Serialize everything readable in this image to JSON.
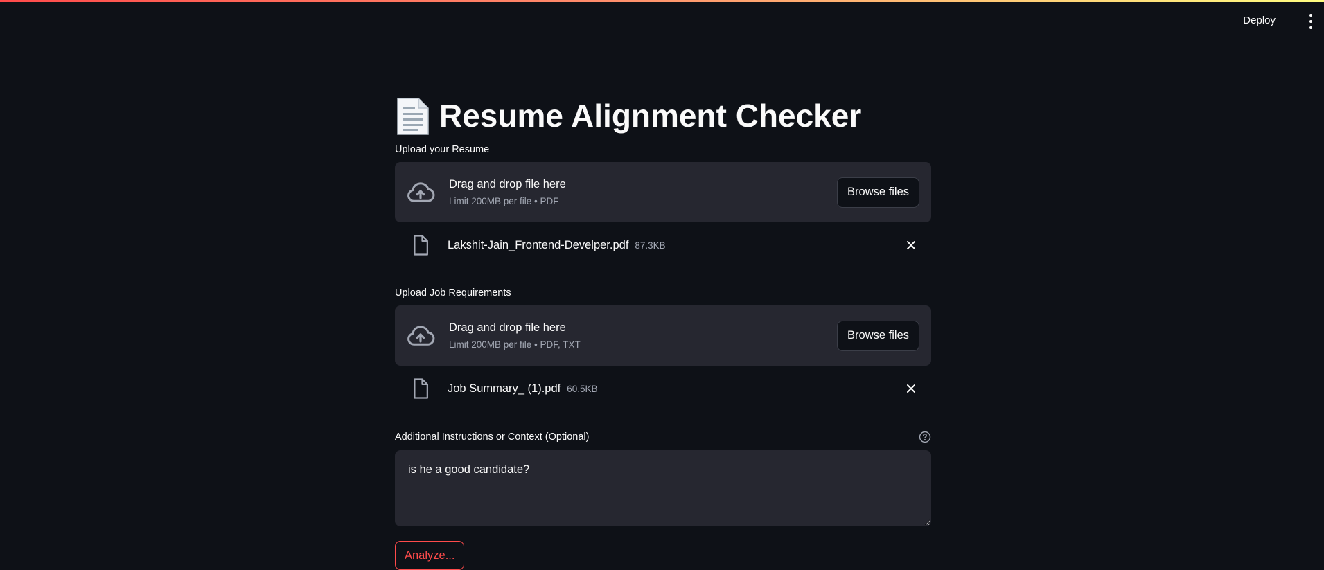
{
  "header": {
    "deploy_label": "Deploy"
  },
  "title": {
    "icon": "page-facing-up-icon",
    "text": "Resume Alignment Checker"
  },
  "resume_upload": {
    "label": "Upload your Resume",
    "drop_text": "Drag and drop file here",
    "limit_text": "Limit 200MB per file • PDF",
    "browse_label": "Browse files",
    "file": {
      "name": "Lakshit-Jain_Frontend-Develper.pdf",
      "size": "87.3KB"
    }
  },
  "job_upload": {
    "label": "Upload Job Requirements",
    "drop_text": "Drag and drop file here",
    "limit_text": "Limit 200MB per file • PDF, TXT",
    "browse_label": "Browse files",
    "file": {
      "name": "Job Summary_ (1).pdf",
      "size": "60.5KB"
    }
  },
  "instructions": {
    "label": "Additional Instructions or Context (Optional)",
    "value": "is he a good candidate?"
  },
  "analyze_label": "Analyze...",
  "colors": {
    "background": "#0e1117",
    "surface": "#262730",
    "accent": "#ff4b4b",
    "muted_text": "#a3a8b4"
  }
}
